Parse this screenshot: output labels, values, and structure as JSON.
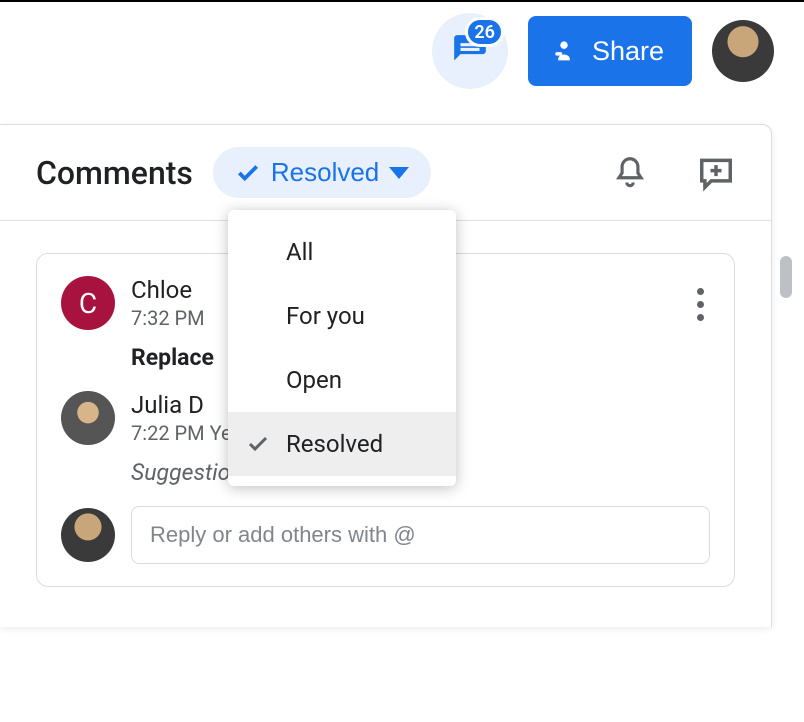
{
  "header": {
    "comment_count": "26",
    "share_label": "Share"
  },
  "panel": {
    "title": "Comments",
    "filter_selected": "Resolved"
  },
  "dropdown": {
    "items": [
      {
        "label": "All",
        "selected": false
      },
      {
        "label": "For you",
        "selected": false
      },
      {
        "label": "Open",
        "selected": false
      },
      {
        "label": "Resolved",
        "selected": true
      }
    ]
  },
  "thread": {
    "comments": [
      {
        "author": "Chloe",
        "author_initial": "C",
        "time": "7:32 PM",
        "text": "Replace",
        "text_style": "bold"
      },
      {
        "author": "Julia D",
        "time": "7:22 PM Yesterday",
        "text": "Suggestion rejected",
        "text_style": "italic"
      }
    ],
    "reply_placeholder": "Reply or add others with @"
  }
}
